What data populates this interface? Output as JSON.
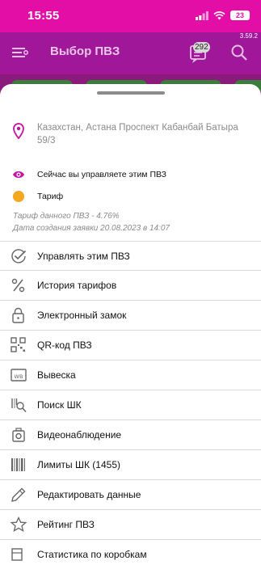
{
  "status_bar": {
    "time": "15:55",
    "battery": "23"
  },
  "app_bar": {
    "title": "Выбор ПВЗ",
    "messages_count": "292",
    "version": "3.59.2"
  },
  "pvz": {
    "address": "Казахстан, Астана Проспект Кабанбай Батыра 59/3",
    "manage_note": "Сейчас вы управляете этим ПВЗ",
    "tariff_label": "Тариф",
    "tariff_info": "Тариф данного ПВЗ - 4.76%",
    "created_info": "Дата создания заявки 20.08.2023 в 14:07"
  },
  "menu": [
    {
      "label": "Управлять этим ПВЗ",
      "icon": "check-circle-icon"
    },
    {
      "label": "История тарифов",
      "icon": "percent-icon"
    },
    {
      "label": "Электронный замок",
      "icon": "lock-icon"
    },
    {
      "label": "QR-код ПВЗ",
      "icon": "qr-code-icon"
    },
    {
      "label": "Вывеска",
      "icon": "signboard-icon"
    },
    {
      "label": "Поиск ШК",
      "icon": "barcode-search-icon"
    },
    {
      "label": "Видеонаблюдение",
      "icon": "camera-icon"
    },
    {
      "label": "Лимиты ШК (1455)",
      "icon": "barcode-icon"
    },
    {
      "label": "Редактировать данные",
      "icon": "pencil-icon"
    },
    {
      "label": "Рейтинг ПВЗ",
      "icon": "star-icon"
    },
    {
      "label": "Статистика по коробкам",
      "icon": "box-stats-icon"
    }
  ],
  "colors": {
    "status_bar": "#e20ea6",
    "app_bar": "#a0179a",
    "accent": "#c3149e",
    "tariff": "#f2a81f"
  }
}
